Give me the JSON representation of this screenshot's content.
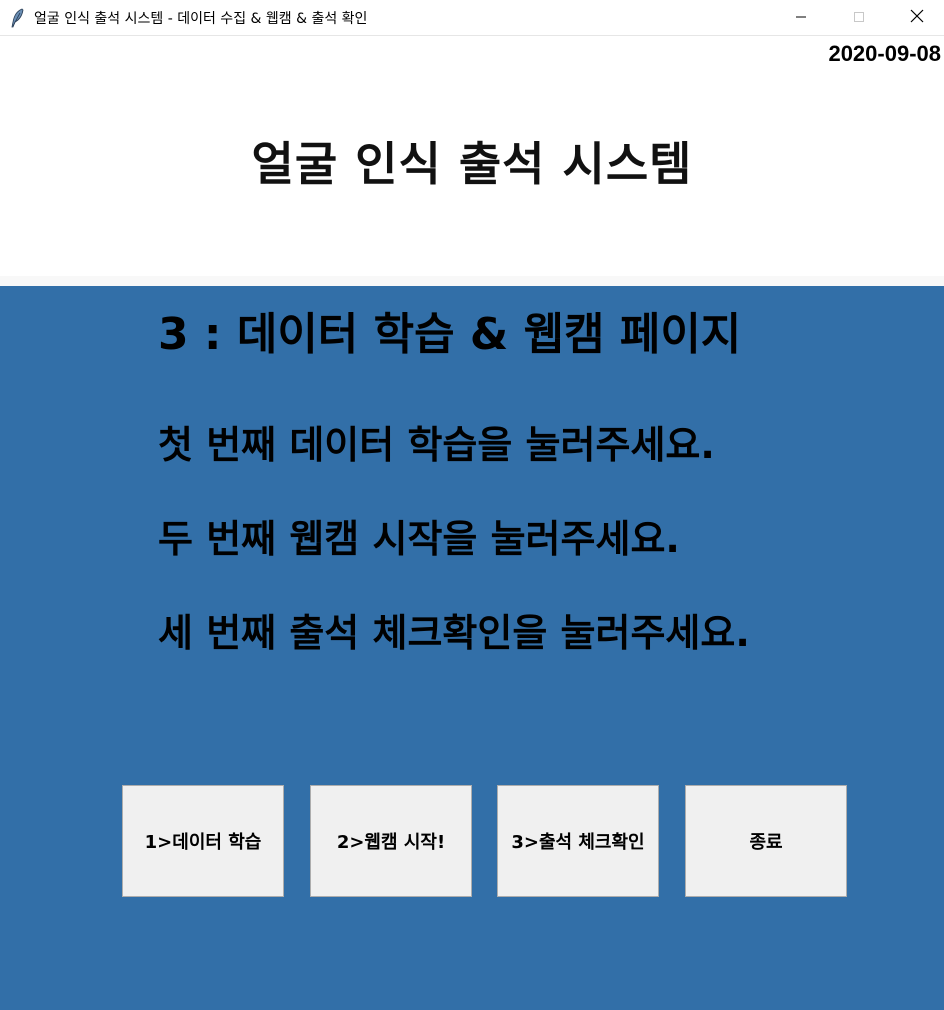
{
  "window": {
    "title": "얼굴 인식 출석 시스템 - 데이터 수집 & 웹캠 & 출석 확인",
    "app_icon": "feather-icon",
    "controls": [
      "minimize-icon",
      "maximize-icon",
      "close-icon"
    ]
  },
  "header": {
    "date": "2020-09-08",
    "heading": "얼굴 인식 출석 시스템"
  },
  "panel": {
    "page_title": "3 : 데이터 학습 & 웹캠 페이지",
    "instructions": [
      "첫 번째 데이터 학습을 눌러주세요.",
      "두 번째 웹캠 시작을 눌러주세요.",
      "세 번째 출석 체크확인을 눌러주세요."
    ],
    "buttons": [
      "1>데이터 학습",
      "2>웹캠 시작!",
      "3>출석 체크확인",
      "종료"
    ]
  },
  "colors": {
    "panel_background": "#326fa8",
    "button_background": "#f0f0f0",
    "text": "#000000"
  }
}
